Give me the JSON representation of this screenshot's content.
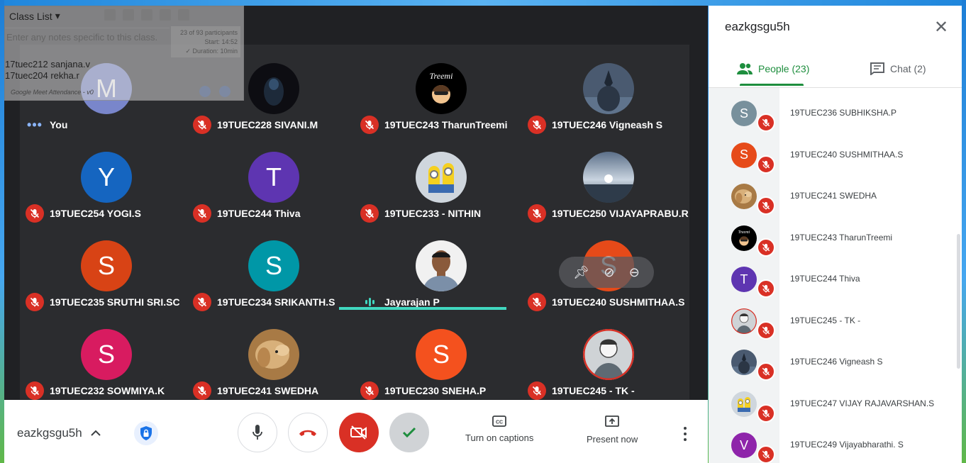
{
  "meeting": {
    "code": "eazkgsgu5h",
    "colors": {
      "mic_off_red": "#d93025",
      "active_green": "#1e8e3e",
      "speaking_teal": "#40d8c0"
    }
  },
  "tiles": [
    {
      "name": "You",
      "avatar_letter": "M",
      "avatar_color": "#7986cb",
      "status": "dots-icon"
    },
    {
      "name": "19TUEC228 SIVANI.M",
      "avatar_type": "photo-dark",
      "status": "mic-off"
    },
    {
      "name": "19TUEC243 TharunTreemi",
      "avatar_type": "photo-treemi",
      "status": "mic-off"
    },
    {
      "name": "19TUEC246 Vigneash S",
      "avatar_type": "photo-statue",
      "status": "mic-off"
    },
    {
      "name": "19TUEC254 YOGI.S",
      "avatar_letter": "Y",
      "avatar_color": "#1565c0",
      "status": "mic-off"
    },
    {
      "name": "19TUEC244 Thiva",
      "avatar_letter": "T",
      "avatar_color": "#5e35b1",
      "status": "mic-off"
    },
    {
      "name": "19TUEC233 - NITHIN",
      "avatar_type": "photo-minions",
      "status": "mic-off"
    },
    {
      "name": "19TUEC250 VIJAYAPRABU.R",
      "avatar_type": "photo-sky",
      "status": "mic-off"
    },
    {
      "name": "19TUEC235 SRUTHI SRI.SC",
      "avatar_letter": "S",
      "avatar_color": "#d84315",
      "status": "mic-off"
    },
    {
      "name": "19TUEC234 SRIKANTH.S",
      "avatar_letter": "S",
      "avatar_color": "#0097a7",
      "status": "mic-off"
    },
    {
      "name": "Jayarajan P",
      "avatar_type": "photo-person",
      "status": "speaking"
    },
    {
      "name": "19TUEC240 SUSHMITHAA.S",
      "avatar_letter": "S",
      "avatar_color": "#e64a19",
      "status": "mic-off"
    },
    {
      "name": "19TUEC232 SOWMIYA.K",
      "avatar_letter": "S",
      "avatar_color": "#d81b60",
      "status": "mic-off"
    },
    {
      "name": "19TUEC241 SWEDHA",
      "avatar_type": "photo-dog",
      "status": "mic-off"
    },
    {
      "name": "19TUEC230 SNEHA.P",
      "avatar_letter": "S",
      "avatar_color": "#f4511e",
      "status": "mic-off"
    },
    {
      "name": "19TUEC245 - TK -",
      "avatar_type": "photo-sketch",
      "status": "mic-off"
    }
  ],
  "extension": {
    "title": "Class List",
    "notes_placeholder": "Enter any notes specific to this class.",
    "stats_participants": "23 of 93 participants",
    "stats_start": "Start: 14:52",
    "stats_duration": "✓ Duration: 10min",
    "entries": [
      "17tuec212 sanjana.v",
      "17tuec204 rekha.r"
    ],
    "footer": "Google Meet Attendance - v0"
  },
  "panel": {
    "title": "eazkgsgu5h",
    "tab_people": "People (23)",
    "tab_chat": "Chat (2)",
    "people": [
      {
        "name": "19TUEC236 SUBHIKSHA.P",
        "avatar_letter": "S",
        "avatar_color": "#78909c"
      },
      {
        "name": "19TUEC240 SUSHMITHAA.S",
        "avatar_letter": "S",
        "avatar_color": "#e64a19"
      },
      {
        "name": "19TUEC241 SWEDHA",
        "avatar_type": "photo-dog"
      },
      {
        "name": "19TUEC243 TharunTreemi",
        "avatar_type": "photo-treemi"
      },
      {
        "name": "19TUEC244 Thiva",
        "avatar_letter": "T",
        "avatar_color": "#5e35b1"
      },
      {
        "name": "19TUEC245 - TK -",
        "avatar_type": "photo-sketch"
      },
      {
        "name": "19TUEC246 Vigneash S",
        "avatar_type": "photo-statue"
      },
      {
        "name": "19TUEC247 VIJAY RAJAVARSHAN.S",
        "avatar_type": "photo-minions"
      },
      {
        "name": "19TUEC249 Vijayabharathi. S",
        "avatar_letter": "V",
        "avatar_color": "#8e24aa"
      }
    ]
  },
  "controls": {
    "captions_label": "Turn on captions",
    "present_label": "Present now"
  }
}
